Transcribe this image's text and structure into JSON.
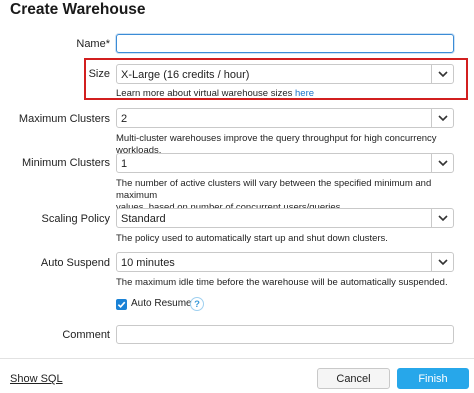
{
  "dialog": {
    "title": "Create Warehouse"
  },
  "name": {
    "label": "Name",
    "required": "*",
    "value": ""
  },
  "size": {
    "label": "Size",
    "value": "X-Large  (16 credits / hour)",
    "help": "Learn more about virtual warehouse sizes",
    "help_link": "here"
  },
  "max_clusters": {
    "label": "Maximum Clusters",
    "value": "2",
    "help": "Multi-cluster warehouses improve the query throughput for high concurrency workloads."
  },
  "min_clusters": {
    "label": "Minimum Clusters",
    "value": "1",
    "help_line1": "The number of active clusters will vary between the specified minimum and maximum",
    "help_line2": "values, based on number of concurrent users/queries."
  },
  "scaling_policy": {
    "label": "Scaling Policy",
    "value": "Standard",
    "help": "The policy used to automatically start up and shut down clusters."
  },
  "auto_suspend": {
    "label": "Auto Suspend",
    "value": "10 minutes",
    "help": "The maximum idle time before the warehouse will be automatically suspended."
  },
  "auto_resume": {
    "label": "Auto Resume",
    "checked": true,
    "help_icon": "?"
  },
  "comment": {
    "label": "Comment",
    "value": ""
  },
  "footer": {
    "show_sql": "Show SQL",
    "cancel": "Cancel",
    "finish": "Finish"
  },
  "colors": {
    "highlight": "#d21f1f",
    "primary": "#27a7ea",
    "link": "#1a73c9"
  }
}
